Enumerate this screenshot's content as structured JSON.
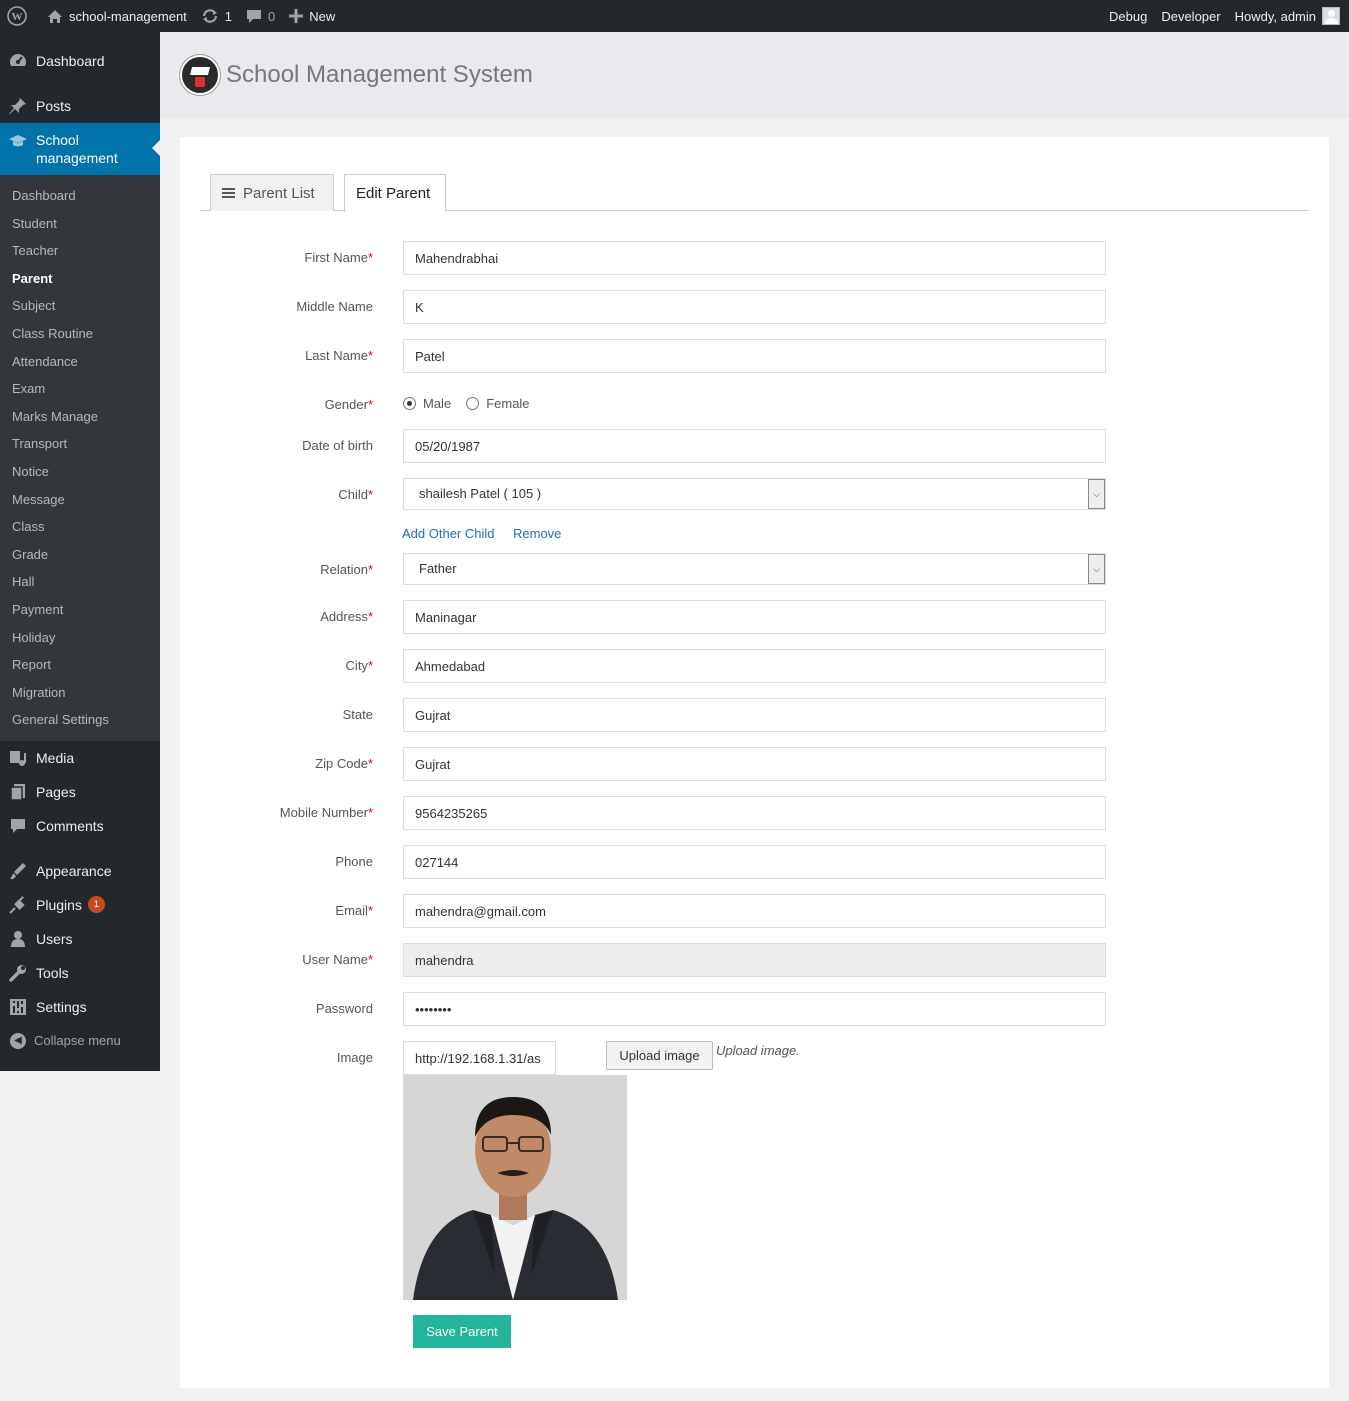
{
  "adminbar": {
    "site_name": "school-management",
    "updates_count": "1",
    "comments_count": "0",
    "new_label": "New",
    "debug_label": "Debug",
    "developer_label": "Developer",
    "howdy_label": "Howdy, admin"
  },
  "sidebar": {
    "top_items": [
      {
        "label": "Dashboard",
        "icon": "dashboard-icon"
      },
      {
        "label": "Posts",
        "icon": "pin-icon"
      }
    ],
    "current": {
      "label_line1": "School",
      "label_line2": "management",
      "icon": "graduation-cap-icon"
    },
    "submenu": [
      "Dashboard",
      "Student",
      "Teacher",
      "Parent",
      "Subject",
      "Class Routine",
      "Attendance",
      "Exam",
      "Marks Manage",
      "Transport",
      "Notice",
      "Message",
      "Class",
      "Grade",
      "Hall",
      "Payment",
      "Holiday",
      "Report",
      "Migration",
      "General Settings"
    ],
    "active_submenu": "Parent",
    "bottom_items": [
      {
        "label": "Media",
        "icon": "media-icon"
      },
      {
        "label": "Pages",
        "icon": "pages-icon"
      },
      {
        "label": "Comments",
        "icon": "comments-icon"
      },
      {
        "label": "Appearance",
        "icon": "appearance-icon"
      },
      {
        "label": "Plugins",
        "icon": "plugins-icon",
        "badge": "1"
      },
      {
        "label": "Users",
        "icon": "users-icon"
      },
      {
        "label": "Tools",
        "icon": "tools-icon"
      },
      {
        "label": "Settings",
        "icon": "settings-icon"
      }
    ],
    "collapse_label": "Collapse menu"
  },
  "header": {
    "title": "School Management System"
  },
  "tabs": {
    "list_label": "Parent List",
    "edit_label": "Edit Parent"
  },
  "form": {
    "first_name_label": "First Name",
    "first_name": "Mahendrabhai",
    "middle_name_label": "Middle Name",
    "middle_name": "K",
    "last_name_label": "Last Name",
    "last_name": "Patel",
    "gender_label": "Gender",
    "gender_male": "Male",
    "gender_female": "Female",
    "gender_selected": "Male",
    "dob_label": "Date of birth",
    "dob": "05/20/1987",
    "child_label": "Child",
    "child_selected": "shailesh Patel ( 105 )",
    "add_child_link": "Add Other Child",
    "remove_link": "Remove",
    "relation_label": "Relation",
    "relation_selected": "Father",
    "address_label": "Address",
    "address": "Maninagar",
    "city_label": "City",
    "city": "Ahmedabad",
    "state_label": "State",
    "state": "Gujrat",
    "zip_label": "Zip Code",
    "zip": "Gujrat",
    "mobile_label": "Mobile Number",
    "mobile": "9564235265",
    "phone_label": "Phone",
    "phone": "027144",
    "email_label": "Email",
    "email": "mahendra@gmail.com",
    "username_label": "User Name",
    "username": "mahendra",
    "password_label": "Password",
    "password": "••••••••",
    "image_label": "Image",
    "image_url": "http://192.168.1.31/as",
    "upload_button": "Upload image",
    "upload_note": "Upload image.",
    "required_mark": "*",
    "save_button": "Save Parent"
  },
  "colors": {
    "adminbar_bg": "#23282d",
    "accent": "#0073aa",
    "save_button": "#22b59c",
    "required": "#dd0000"
  }
}
